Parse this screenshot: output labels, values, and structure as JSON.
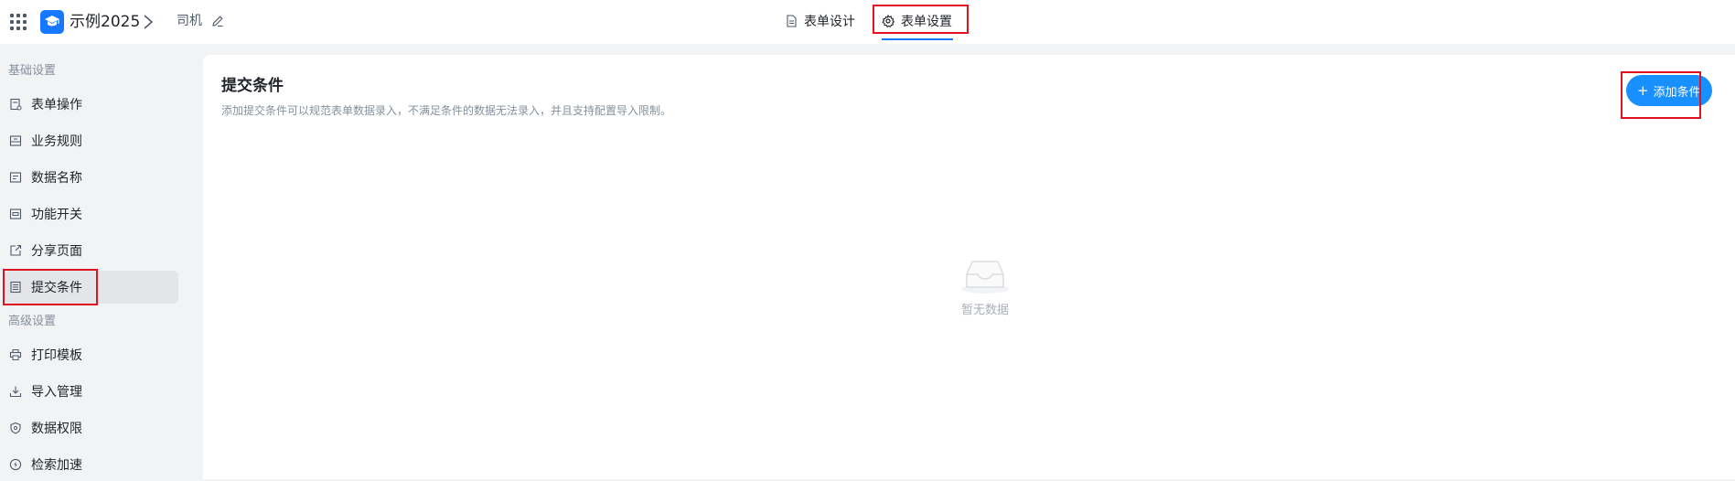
{
  "topbar": {
    "app_name": "示例2025",
    "form_name": "司机",
    "tabs": [
      {
        "label": "表单设计",
        "icon": "document-icon",
        "active": false
      },
      {
        "label": "表单设置",
        "icon": "gear-icon",
        "active": true
      }
    ]
  },
  "sidebar": {
    "basic_group_label": "基础设置",
    "basic_items": [
      {
        "label": "表单操作",
        "icon": "form-edit-icon"
      },
      {
        "label": "业务规则",
        "icon": "business-rule-icon"
      },
      {
        "label": "数据名称",
        "icon": "data-title-icon"
      },
      {
        "label": "功能开关",
        "icon": "toggle-icon"
      },
      {
        "label": "分享页面",
        "icon": "share-icon"
      },
      {
        "label": "提交条件",
        "icon": "list-icon",
        "active": true
      }
    ],
    "advanced_group_label": "高级设置",
    "advanced_items": [
      {
        "label": "打印模板",
        "icon": "printer-icon"
      },
      {
        "label": "导入管理",
        "icon": "import-icon"
      },
      {
        "label": "数据权限",
        "icon": "shield-icon"
      },
      {
        "label": "检索加速",
        "icon": "lightning-icon"
      }
    ]
  },
  "main": {
    "title": "提交条件",
    "description": "添加提交条件可以规范表单数据录入，不满足条件的数据无法录入，并且支持配置导入限制。",
    "add_button_label": "添加条件",
    "empty_text": "暂无数据"
  },
  "colors": {
    "accent": "#1677ff",
    "button": "#1890ff",
    "highlight_box": "#e0121e",
    "active_item_bg": "#e3e5e8"
  }
}
